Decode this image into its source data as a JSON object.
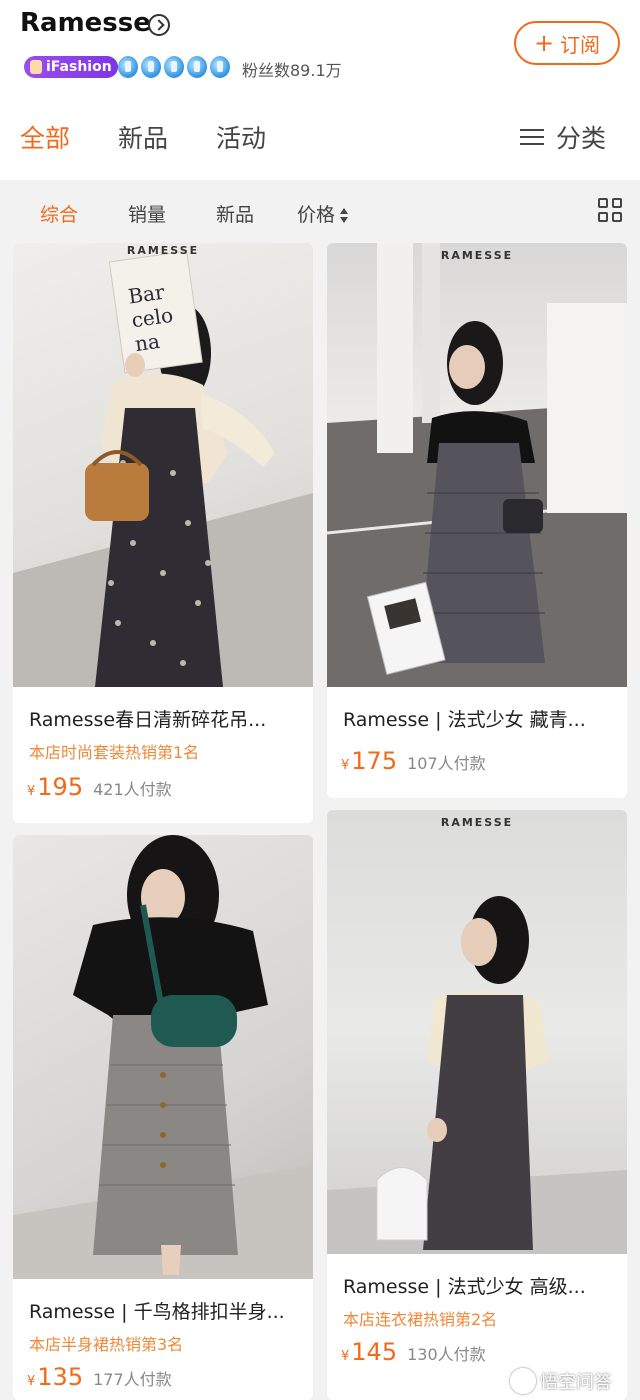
{
  "header": {
    "shop_name": "Ramesse",
    "subscribe_label": "订阅",
    "badge_label": "iFashion",
    "followers_label": "粉丝数89.1万"
  },
  "tabs": [
    {
      "label": "全部",
      "active": true
    },
    {
      "label": "新品",
      "active": false
    },
    {
      "label": "活动",
      "active": false
    }
  ],
  "categories_label": "分类",
  "sort_options": [
    {
      "label": "综合",
      "active": true
    },
    {
      "label": "销量",
      "active": false
    },
    {
      "label": "新品",
      "active": false
    },
    {
      "label": "价格",
      "active": false
    }
  ],
  "products": [
    {
      "brand_mark": "RAMESSE",
      "title": "Ramesse春日清新碎花吊...",
      "rank": "本店时尚套装热销第1名",
      "currency": "¥",
      "price": "195",
      "buyers": "421人付款"
    },
    {
      "brand_mark": "RAMESSE",
      "title": "Ramesse | 法式少女 藏青...",
      "rank": "",
      "currency": "¥",
      "price": "175",
      "buyers": "107人付款"
    },
    {
      "brand_mark": "",
      "title": "Ramesse | 千鸟格排扣半身...",
      "rank": "本店半身裙热销第3名",
      "currency": "¥",
      "price": "135",
      "buyers": "177人付款"
    },
    {
      "brand_mark": "RAMESSE",
      "title": "Ramesse | 法式少女 高级...",
      "rank": "本店连衣裙热销第2名",
      "currency": "¥",
      "price": "145",
      "buyers": "130人付款"
    }
  ],
  "book_cover_text": "Bar\ncelo\nna",
  "watermark_text": "悟空问答",
  "colors": {
    "accent": "#f06a1a",
    "rank": "#f0883a",
    "badge": "#8a3fec"
  }
}
